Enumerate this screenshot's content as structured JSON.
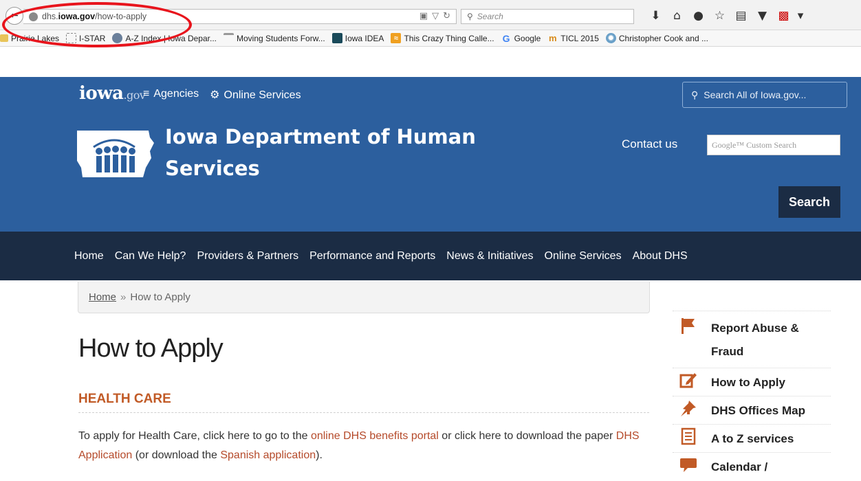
{
  "browser": {
    "url_domain_prefix": "dhs.",
    "url_domain": "iowa.gov",
    "url_path": "/how-to-apply",
    "search_placeholder": "Search",
    "bookmarks": [
      {
        "label": "Prairie Lakes",
        "icon": "folder-icon"
      },
      {
        "label": "I-STAR",
        "icon": "dashed-box-icon"
      },
      {
        "label": "A-Z Index | Iowa Depar...",
        "icon": "globe-icon"
      },
      {
        "label": "Moving Students Forw...",
        "icon": "page-icon"
      },
      {
        "label": "Iowa IDEA",
        "icon": "screen-icon"
      },
      {
        "label": "This Crazy Thing Calle...",
        "icon": "rss-icon"
      },
      {
        "label": "Google",
        "icon": "google-icon"
      },
      {
        "label": "TICL 2015",
        "icon": "m-icon"
      },
      {
        "label": "Christopher Cook and ...",
        "icon": "cog-icon"
      }
    ]
  },
  "header": {
    "logo_main": "iowa",
    "logo_gov": ".gov",
    "agencies_label": "Agencies",
    "online_services_label": "Online Services",
    "search_all_placeholder": "Search All of Iowa.gov...",
    "dept_title": "Iowa Department of Human Services",
    "contact_label": "Contact us",
    "google_placeholder": "Google™ Custom Search",
    "search_button": "Search"
  },
  "nav": {
    "items": [
      "Home",
      "Can We Help?",
      "Providers & Partners",
      "Performance and Reports",
      "News & Initiatives",
      "Online Services",
      "About DHS"
    ]
  },
  "breadcrumb": {
    "home": "Home",
    "separator": "»",
    "current": "How to Apply"
  },
  "content": {
    "title": "How to Apply",
    "section_heading": "HEALTH CARE",
    "para_1": "To apply for Health Care, click here to go to the ",
    "link_portal": "online DHS benefits portal",
    "para_2": " or click here to download the paper ",
    "link_application": "DHS Application",
    "para_3": " (or download the ",
    "link_spanish": "Spanish application",
    "para_4": ")."
  },
  "sidebar": {
    "items": [
      {
        "label": "Report Abuse & Fraud",
        "icon": "flag-icon"
      },
      {
        "label": "How to Apply",
        "icon": "edit-icon"
      },
      {
        "label": "DHS Offices Map",
        "icon": "pushpin-icon"
      },
      {
        "label": "A to Z services",
        "icon": "list-icon"
      },
      {
        "label": "Calendar /",
        "icon": "chat-icon"
      }
    ]
  },
  "colors": {
    "header_blue": "#2c5f9e",
    "nav_dark": "#1b2c44",
    "accent_orange": "#c15a26",
    "link_red": "#b54a2a"
  }
}
